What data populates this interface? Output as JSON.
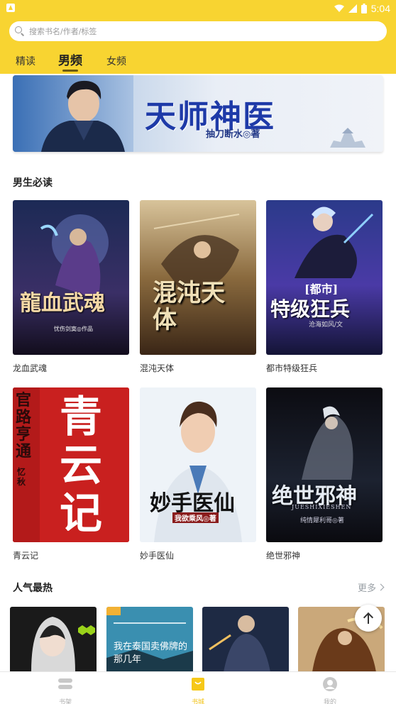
{
  "status_bar": {
    "time": "5:04"
  },
  "search": {
    "placeholder": "搜索书名/作者/标签"
  },
  "tabs": [
    {
      "label": "精读"
    },
    {
      "label": "男频"
    },
    {
      "label": "女频"
    }
  ],
  "banner": {
    "title": "天师神医",
    "author": "抽刀断水◎著"
  },
  "section_boys": {
    "title": "男生必读",
    "books": [
      {
        "title": "龙血武魂",
        "cover_title": "龍血武魂",
        "cover_author": "忧伤剑寞◎作品"
      },
      {
        "title": "混沌天体",
        "cover_title": "混沌天体"
      },
      {
        "title": "都市特级狂兵",
        "cover_title": "特级狂兵",
        "cover_tag": "[都市]",
        "cover_author": "沧海如风/文"
      },
      {
        "title": "青云记",
        "cover_title": "青云记",
        "cover_side": "官路亨通",
        "cover_author": "忆秋"
      },
      {
        "title": "妙手医仙",
        "cover_title": "妙手医仙",
        "cover_author": "我欲乘风◎著"
      },
      {
        "title": "绝世邪神",
        "cover_title": "绝世邪神",
        "cover_sub": "JUESHIXIESHEN",
        "cover_author": "纯情犀利哥◎著"
      }
    ]
  },
  "section_hot": {
    "title": "人气最热",
    "more": "更多",
    "items": [
      {
        "name": "hot-1"
      },
      {
        "name": "hot-2",
        "cover_text": "我在泰国卖佛牌的那几年"
      },
      {
        "name": "hot-3"
      },
      {
        "name": "hot-4"
      }
    ]
  },
  "bottom_nav": [
    {
      "label": "书架",
      "icon": "bookshelf-icon"
    },
    {
      "label": "书城",
      "icon": "store-icon"
    },
    {
      "label": "我的",
      "icon": "profile-icon"
    }
  ],
  "colors": {
    "accent": "#f8d431",
    "accent_dark": "#f2c319"
  }
}
